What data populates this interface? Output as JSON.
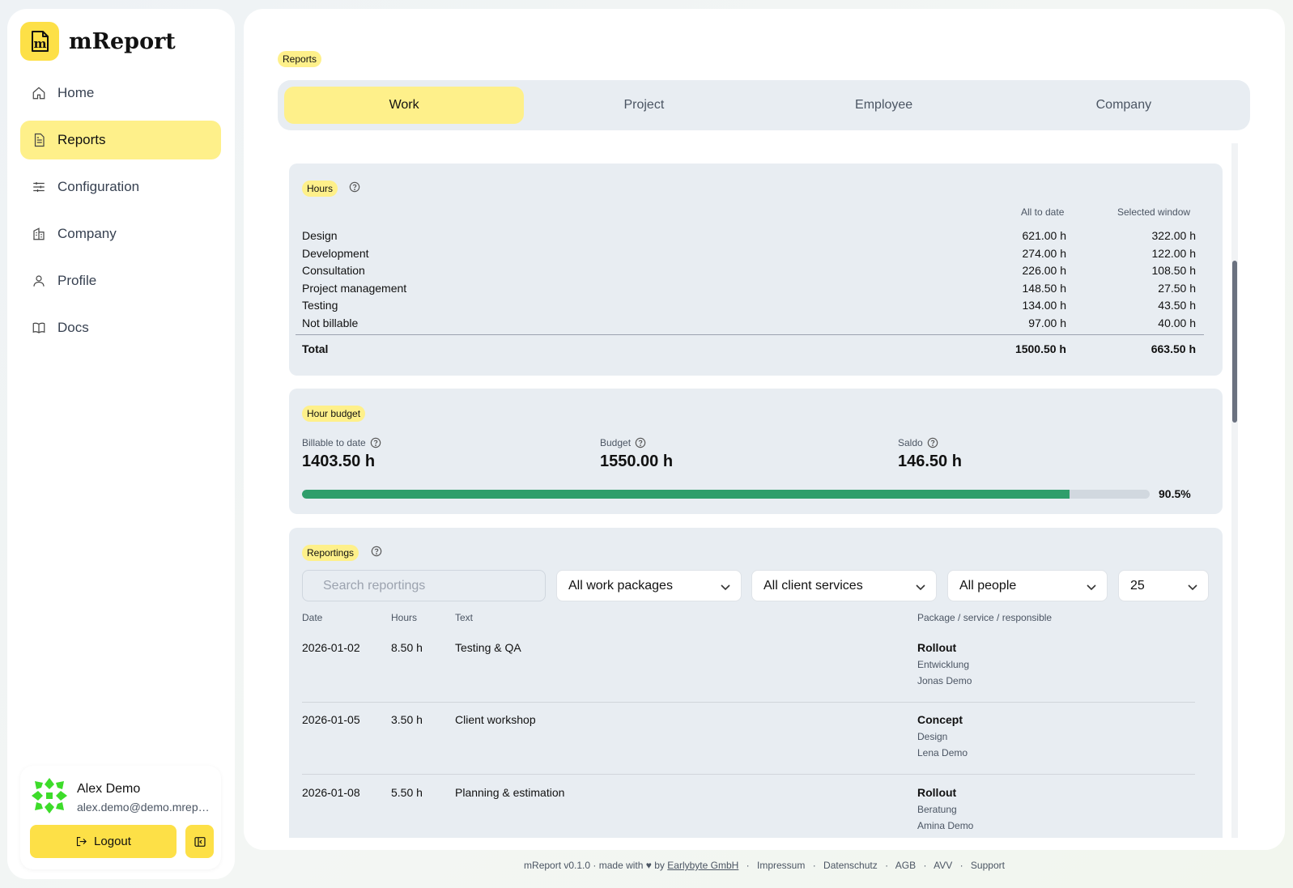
{
  "app": {
    "name": "mReport"
  },
  "sidebar": {
    "items": [
      {
        "label": "Home",
        "icon": "home-icon"
      },
      {
        "label": "Reports",
        "icon": "report-icon",
        "active": true
      },
      {
        "label": "Configuration",
        "icon": "sliders-icon"
      },
      {
        "label": "Company",
        "icon": "building-icon"
      },
      {
        "label": "Profile",
        "icon": "user-icon"
      },
      {
        "label": "Docs",
        "icon": "book-icon"
      }
    ],
    "user": {
      "name": "Alex Demo",
      "email": "alex.demo@demo.mreport.io",
      "logout_label": "Logout"
    }
  },
  "page": {
    "badge": "Reports",
    "tabs": [
      "Work",
      "Project",
      "Employee",
      "Company"
    ],
    "active_tab": "Work"
  },
  "hours": {
    "badge": "Hours",
    "col_all": "All to date",
    "col_window": "Selected window",
    "rows": [
      {
        "label": "Design",
        "all": "621.00 h",
        "window": "322.00 h"
      },
      {
        "label": "Development",
        "all": "274.00 h",
        "window": "122.00 h"
      },
      {
        "label": "Consultation",
        "all": "226.00 h",
        "window": "108.50 h"
      },
      {
        "label": "Project management",
        "all": "148.50 h",
        "window": "27.50 h"
      },
      {
        "label": "Testing",
        "all": "134.00 h",
        "window": "43.50 h"
      },
      {
        "label": "Not billable",
        "all": "97.00 h",
        "window": "40.00 h"
      }
    ],
    "total": {
      "label": "Total",
      "all": "1500.50 h",
      "window": "663.50 h"
    }
  },
  "budget": {
    "badge": "Hour budget",
    "billable_label": "Billable to date",
    "billable_value": "1403.50 h",
    "budget_label": "Budget",
    "budget_value": "1550.00 h",
    "saldo_label": "Saldo",
    "saldo_value": "146.50 h",
    "progress_pct": 90.5,
    "progress_text": "90.5%",
    "progress_color": "#2f9e6b"
  },
  "reportings": {
    "badge": "Reportings",
    "search_placeholder": "Search reportings",
    "filters": {
      "work_packages": "All work packages",
      "client_services": "All client services",
      "people": "All people",
      "page_size": "25"
    },
    "columns": {
      "date": "Date",
      "hours": "Hours",
      "text": "Text",
      "package": "Package / service / responsible"
    },
    "rows": [
      {
        "date": "2026-01-02",
        "hours": "8.50 h",
        "text": "Testing & QA",
        "package": "Rollout",
        "service": "Entwicklung",
        "responsible": "Jonas Demo"
      },
      {
        "date": "2026-01-05",
        "hours": "3.50 h",
        "text": "Client workshop",
        "package": "Concept",
        "service": "Design",
        "responsible": "Lena Demo"
      },
      {
        "date": "2026-01-08",
        "hours": "5.50 h",
        "text": "Planning & estimation",
        "package": "Rollout",
        "service": "Beratung",
        "responsible": "Amina Demo"
      }
    ]
  },
  "footer": {
    "version_text": "mReport v0.1.0 · made with",
    "by_text": "by",
    "company_link": "Earlybyte GmbH",
    "links": [
      "Impressum",
      "Datenschutz",
      "AGB",
      "AVV",
      "Support"
    ]
  },
  "colors": {
    "accent": "#fde047",
    "accent_light": "#fef08a",
    "card_bg": "#e8edf2"
  }
}
